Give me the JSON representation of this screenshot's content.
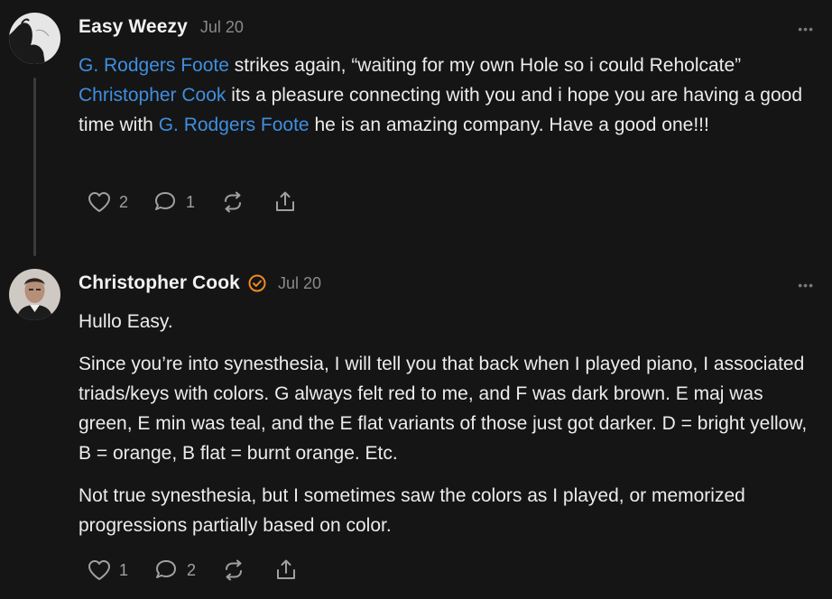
{
  "comments": [
    {
      "author": "Easy Weezy",
      "date": "Jul 20",
      "verified": false,
      "body_segments": [
        {
          "text": "G. Rodgers Foote",
          "link": true
        },
        {
          "text": " strikes again, “waiting for my own Hole so i could Reholcate” ",
          "link": false
        },
        {
          "text": "Christopher Cook",
          "link": true
        },
        {
          "text": " its a pleasure connecting with you and i hope you are having a good time with ",
          "link": false
        },
        {
          "text": "G. Rodgers Foote",
          "link": true
        },
        {
          "text": " he is an amazing company. Have a good one!!!",
          "link": false
        }
      ],
      "likes": "2",
      "replies": "1",
      "more_label": "•••"
    },
    {
      "author": "Christopher Cook",
      "date": "Jul 20",
      "verified": true,
      "paragraphs": [
        "Hullo Easy.",
        "Since you’re into synesthesia, I will tell you that back when I played piano, I associated triads/keys with colors. G always felt red to me, and F was dark brown. E maj was green, E min was teal, and the E flat variants of those just got darker. D = bright yellow, B = orange, B flat = burnt orange. Etc.",
        "Not true synesthesia, but I sometimes saw the colors as I played, or memorized progressions partially based on color."
      ],
      "likes": "1",
      "replies": "2",
      "more_label": "•••"
    }
  ],
  "colors": {
    "background": "#151515",
    "link": "#3f8fe0",
    "verified_badge": "#f08a24",
    "muted": "#8a8a8a"
  },
  "icons": [
    "heart-icon",
    "comment-icon",
    "restack-icon",
    "share-icon",
    "verified-badge-icon",
    "more-icon"
  ]
}
